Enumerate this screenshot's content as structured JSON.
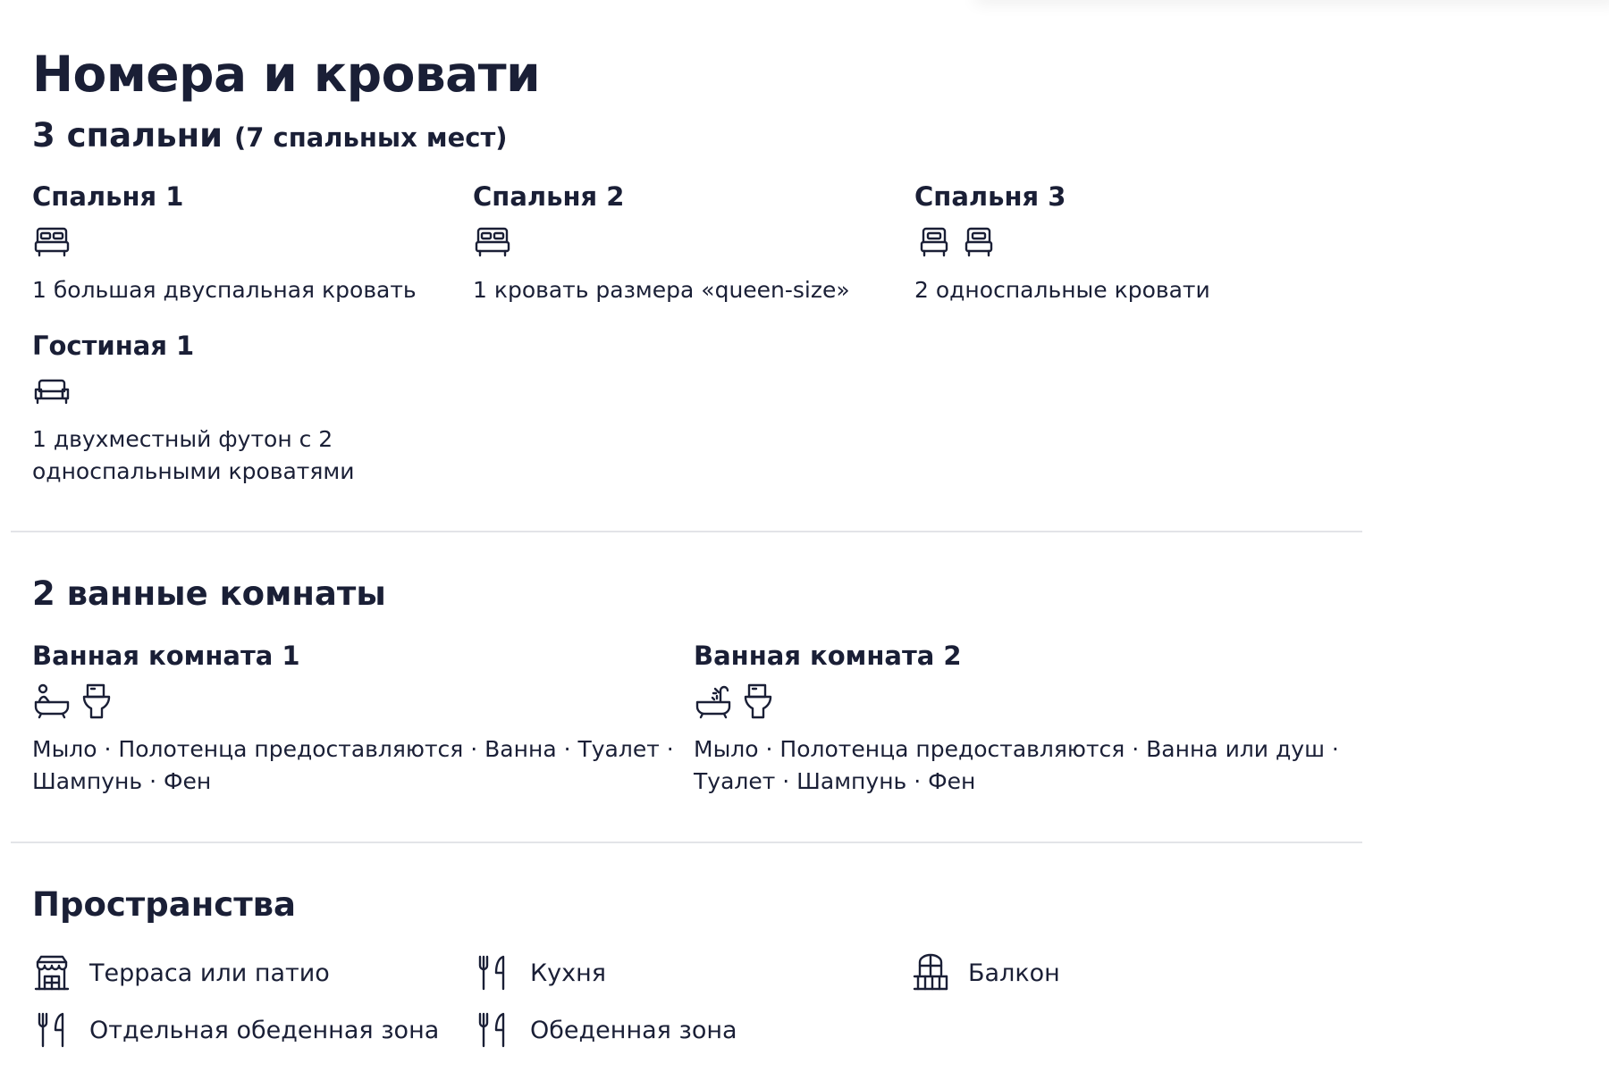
{
  "page": {
    "title": "Номера и кровати"
  },
  "bedrooms": {
    "title": "3 спальни",
    "subtitle": "(7 спальных мест)",
    "items": [
      {
        "name": "Спальня 1",
        "icons": [
          "double-bed-icon"
        ],
        "description": "1 большая двуспальная кровать"
      },
      {
        "name": "Спальня 2",
        "icons": [
          "double-bed-icon"
        ],
        "description": "1 кровать размера «queen-size»"
      },
      {
        "name": "Спальня 3",
        "icons": [
          "single-bed-icon",
          "single-bed-icon"
        ],
        "description": "2 односпальные кровати"
      },
      {
        "name": "Гостиная 1",
        "icons": [
          "futon-icon"
        ],
        "description": "1 двухместный футон с 2 односпальными кроватями"
      }
    ]
  },
  "bathrooms": {
    "title": "2 ванные комнаты",
    "items": [
      {
        "name": "Ванная комната 1",
        "icons": [
          "bathtub-icon",
          "toilet-icon"
        ],
        "description": "Мыло · Полотенца предоставляются · Ванна · Туалет · Шампунь · Фен"
      },
      {
        "name": "Ванная комната 2",
        "icons": [
          "bath-shower-icon",
          "toilet-icon"
        ],
        "description": "Мыло · Полотенца предоставляются · Ванна или душ · Туалет · Шампунь · Фен"
      }
    ]
  },
  "spaces": {
    "title": "Пространства",
    "items": [
      {
        "label": "Терраса или патио",
        "icon": "terrace-icon"
      },
      {
        "label": "Кухня",
        "icon": "fork-knife-icon"
      },
      {
        "label": "Балкон",
        "icon": "balcony-icon"
      },
      {
        "label": "Отдельная обеденная зона",
        "icon": "fork-knife-icon"
      },
      {
        "label": "Обеденная зона",
        "icon": "fork-knife-icon"
      }
    ]
  },
  "colors": {
    "text": "#1a1f36",
    "divider": "#e3e4e8",
    "background": "#ffffff"
  }
}
